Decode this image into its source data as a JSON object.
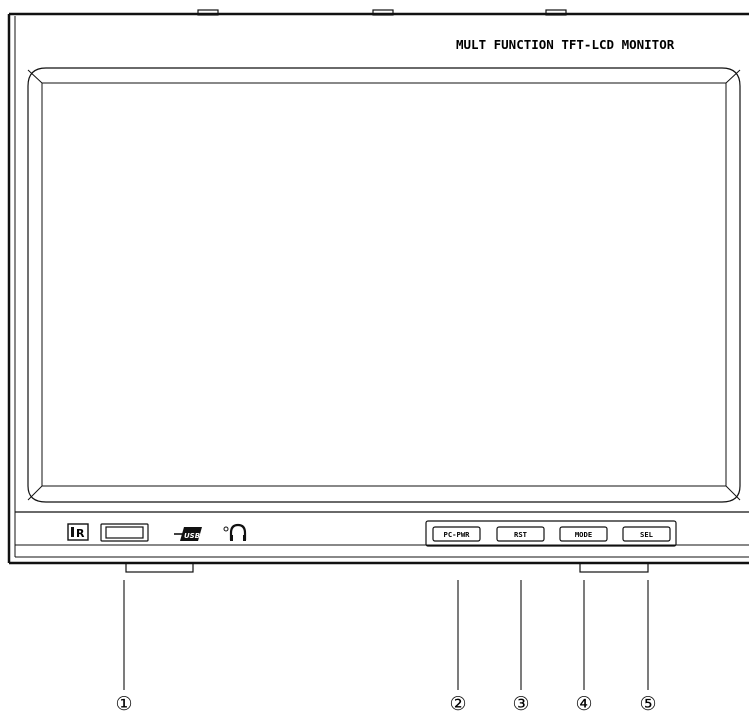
{
  "monitor": {
    "title": "MULT FUNCTION TFT-LCD MONITOR"
  },
  "front_panel": {
    "ir_label": "R",
    "usb_label": "USB",
    "headphone_icon": "headphone-icon",
    "buttons": [
      {
        "id": "pc-pwr",
        "label": "PC-PWR"
      },
      {
        "id": "rst",
        "label": "RST"
      },
      {
        "id": "mode",
        "label": "MODE"
      },
      {
        "id": "sel",
        "label": "SEL"
      }
    ]
  },
  "callouts": [
    "①",
    "②",
    "③",
    "④",
    "⑤"
  ]
}
